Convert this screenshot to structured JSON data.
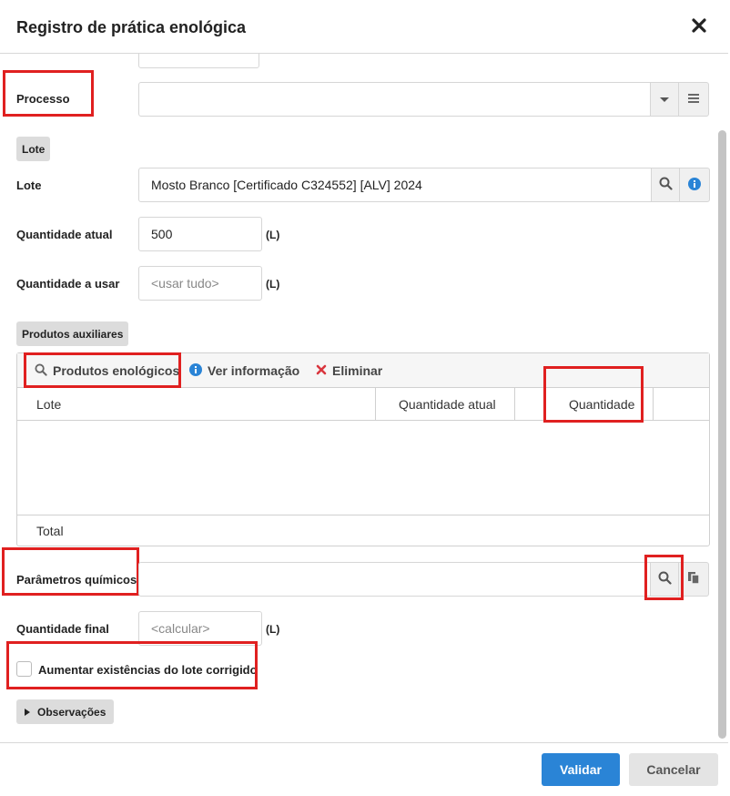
{
  "modal": {
    "title": "Registro de prática enológica",
    "close_icon": "close-icon"
  },
  "form": {
    "processo_label": "Processo",
    "processo_value": "",
    "lote_section": "Lote",
    "lote_label": "Lote",
    "lote_value": "Mosto Branco [Certificado C324552] [ALV] 2024",
    "quantidade_atual_label": "Quantidade atual",
    "quantidade_atual_value": "500",
    "quantidade_atual_unit": "(L)",
    "quantidade_usar_label": "Quantidade a usar",
    "quantidade_usar_placeholder": "<usar tudo>",
    "quantidade_usar_unit": "(L)",
    "produtos_section": "Produtos auxiliares",
    "parametros_label": "Parâmetros químicos",
    "parametros_value": "",
    "quantidade_final_label": "Quantidade final",
    "quantidade_final_placeholder": "<calcular>",
    "quantidade_final_unit": "(L)",
    "aumentar_label": "Aumentar existências do lote corrigido",
    "aumentar_checked": false,
    "observacoes_label": "Observações"
  },
  "grid": {
    "toolbar": {
      "produtos_enologicos": "Produtos enológicos",
      "ver_informacao": "Ver informação",
      "eliminar": "Eliminar"
    },
    "columns": [
      "Lote",
      "Quantidade atual",
      "Quantidade"
    ],
    "rows": [],
    "footer_label": "Total"
  },
  "footer": {
    "validar": "Validar",
    "cancelar": "Cancelar"
  },
  "colors": {
    "primary": "#2a84d6",
    "highlight": "#e02020",
    "info": "#2a84d6",
    "delete": "#d9363e"
  }
}
